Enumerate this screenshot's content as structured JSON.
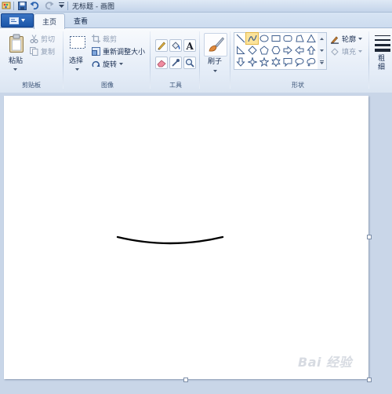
{
  "window": {
    "title": "无标题 - 画图"
  },
  "tabs": [
    {
      "label": "主页"
    },
    {
      "label": "查看"
    }
  ],
  "ribbon": {
    "clipboard": {
      "paste": "粘贴",
      "cut": "剪切",
      "copy": "复制",
      "group": "剪贴板"
    },
    "image": {
      "select": "选择",
      "crop": "裁剪",
      "resize": "重新调整大小",
      "rotate": "旋转",
      "group": "图像"
    },
    "tools": {
      "group": "工具"
    },
    "brushes": {
      "label": "刷子"
    },
    "shapes": {
      "outline": "轮廓",
      "fill": "填充",
      "group": "形状"
    },
    "size": {
      "label": "粗细"
    }
  },
  "canvas": {
    "watermark": "Bai 经验"
  },
  "colors": {
    "file_tab": "#1a55a8",
    "ribbon_bg": "#e4ecf7",
    "workspace": "#c9d6e8",
    "selected_shape": "#fbe39a"
  }
}
